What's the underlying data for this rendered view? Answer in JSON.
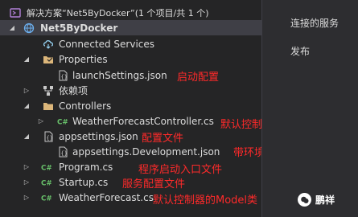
{
  "solution": {
    "label": "解决方案“Net5ByDocker”(1 个项目/共 1 个)"
  },
  "project": {
    "label": "Net5ByDocker"
  },
  "tree": {
    "connected_services": "Connected Services",
    "properties": "Properties",
    "launch_settings": "launchSettings.json",
    "dependencies": "依赖项",
    "controllers": "Controllers",
    "weather_controller": "WeatherForecastController.cs",
    "appsettings": "appsettings.json",
    "appsettings_dev": "appsettings.Development.json",
    "program": "Program.cs",
    "startup": "Startup.cs",
    "weather_forecast": "WeatherForecast.cs"
  },
  "annotations": {
    "launch_settings": "启动配置",
    "weather_controller": "默认控制器",
    "appsettings": "配置文件",
    "appsettings_dev": "带环境的配置文件",
    "program": "程序启动入口文件",
    "startup": "服务配置文件",
    "weather_forecast": "默认控制器的Model类"
  },
  "side_panel": {
    "connected_services": "连接的服务",
    "publish": "发布"
  },
  "watermark": {
    "text": "鹏祥"
  },
  "icons": {
    "solution": "solution-icon",
    "project": "project-globe-icon",
    "folder": "folder-icon",
    "json": "json-file-icon",
    "csharp": "csharp-file-icon",
    "dependencies": "dependencies-icon",
    "connected": "connected-services-icon"
  },
  "colors": {
    "accent_red": "#ff2a2a",
    "folder": "#dcb67a",
    "csharp": "#68c06a"
  }
}
